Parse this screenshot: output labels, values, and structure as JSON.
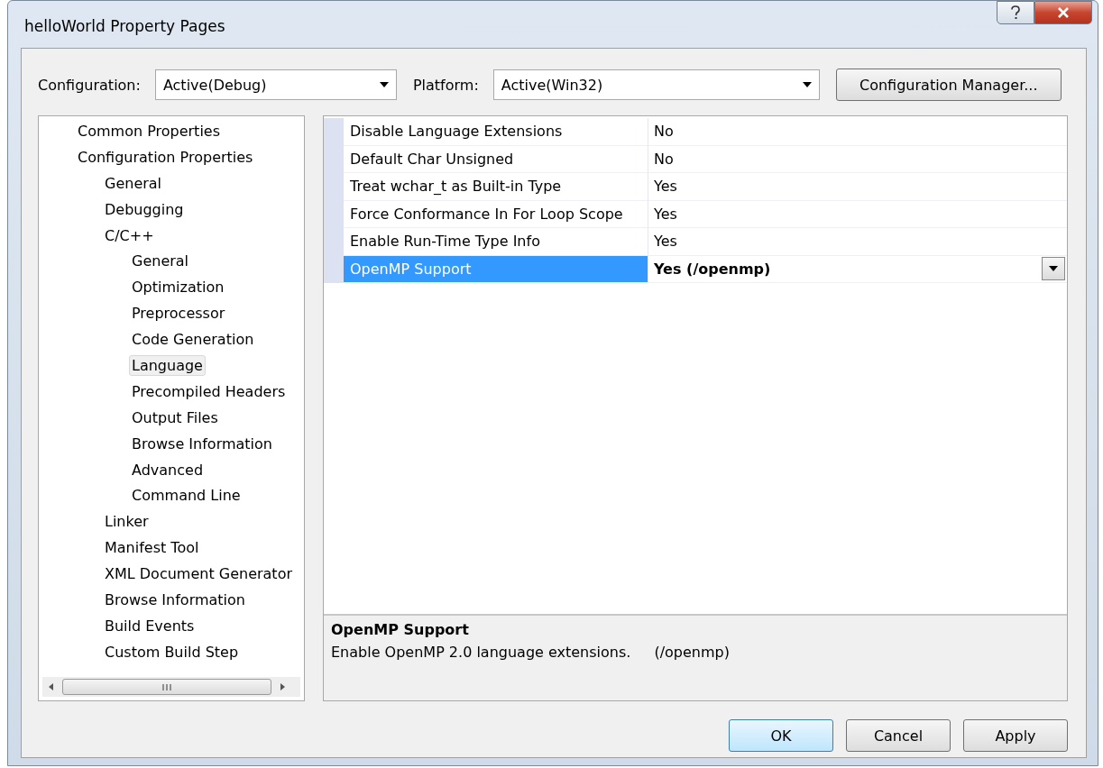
{
  "window": {
    "title": "helloWorld Property Pages"
  },
  "toolbar": {
    "configuration_label": "Configuration:",
    "configuration_value": "Active(Debug)",
    "platform_label": "Platform:",
    "platform_value": "Active(Win32)",
    "manager_button": "Configuration Manager..."
  },
  "tree": [
    {
      "label": "Common Properties",
      "selected": false
    },
    {
      "label": "Configuration Properties",
      "selected": false,
      "children": [
        {
          "label": "General",
          "selected": false
        },
        {
          "label": "Debugging",
          "selected": false
        },
        {
          "label": "C/C++",
          "selected": false,
          "children": [
            {
              "label": "General",
              "selected": false
            },
            {
              "label": "Optimization",
              "selected": false
            },
            {
              "label": "Preprocessor",
              "selected": false
            },
            {
              "label": "Code Generation",
              "selected": false
            },
            {
              "label": "Language",
              "selected": true
            },
            {
              "label": "Precompiled Headers",
              "selected": false
            },
            {
              "label": "Output Files",
              "selected": false
            },
            {
              "label": "Browse Information",
              "selected": false
            },
            {
              "label": "Advanced",
              "selected": false
            },
            {
              "label": "Command Line",
              "selected": false
            }
          ]
        },
        {
          "label": "Linker",
          "selected": false
        },
        {
          "label": "Manifest Tool",
          "selected": false
        },
        {
          "label": "XML Document Generator",
          "selected": false
        },
        {
          "label": "Browse Information",
          "selected": false
        },
        {
          "label": "Build Events",
          "selected": false
        },
        {
          "label": "Custom Build Step",
          "selected": false
        }
      ]
    }
  ],
  "properties": [
    {
      "name": "Disable Language Extensions",
      "value": "No",
      "selected": false
    },
    {
      "name": "Default Char Unsigned",
      "value": "No",
      "selected": false
    },
    {
      "name": "Treat wchar_t as Built-in Type",
      "value": "Yes",
      "selected": false
    },
    {
      "name": "Force Conformance In For Loop Scope",
      "value": "Yes",
      "selected": false
    },
    {
      "name": "Enable Run-Time Type Info",
      "value": "Yes",
      "selected": false
    },
    {
      "name": "OpenMP Support",
      "value": "Yes (/openmp)",
      "selected": true
    }
  ],
  "description": {
    "title": "OpenMP Support",
    "text": "Enable OpenMP 2.0 language extensions.",
    "switch": "(/openmp)"
  },
  "buttons": [
    {
      "label": "OK",
      "default": true
    },
    {
      "label": "Cancel",
      "default": false
    },
    {
      "label": "Apply",
      "default": false
    }
  ]
}
